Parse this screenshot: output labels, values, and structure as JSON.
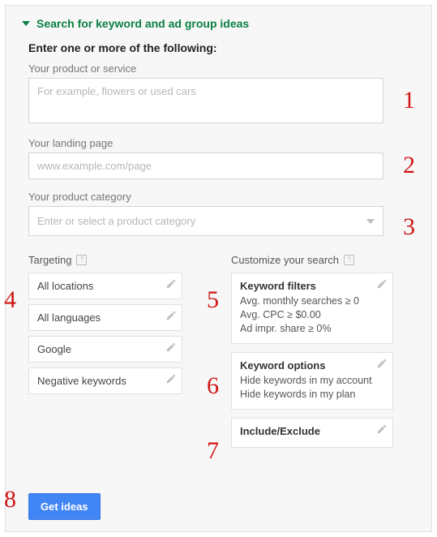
{
  "header": {
    "title": "Search for keyword and ad group ideas"
  },
  "intro": "Enter one or more of the following:",
  "fields": {
    "product": {
      "label": "Your product or service",
      "placeholder": "For example, flowers or used cars"
    },
    "landing": {
      "label": "Your landing page",
      "placeholder": "www.example.com/page"
    },
    "category": {
      "label": "Your product category",
      "placeholder": "Enter or select a product category"
    }
  },
  "targeting": {
    "title": "Targeting",
    "items": [
      "All locations",
      "All languages",
      "Google",
      "Negative keywords"
    ]
  },
  "customize": {
    "title": "Customize your search",
    "filters": {
      "title": "Keyword filters",
      "lines": [
        "Avg. monthly searches ≥ 0",
        "Avg. CPC ≥ $0.00",
        "Ad impr. share ≥ 0%"
      ]
    },
    "options": {
      "title": "Keyword options",
      "lines": [
        "Hide keywords in my account",
        "Hide keywords in my plan"
      ]
    },
    "include": {
      "title": "Include/Exclude"
    }
  },
  "button": "Get ideas",
  "annotations": [
    "1",
    "2",
    "3",
    "4",
    "5",
    "6",
    "7",
    "8"
  ]
}
